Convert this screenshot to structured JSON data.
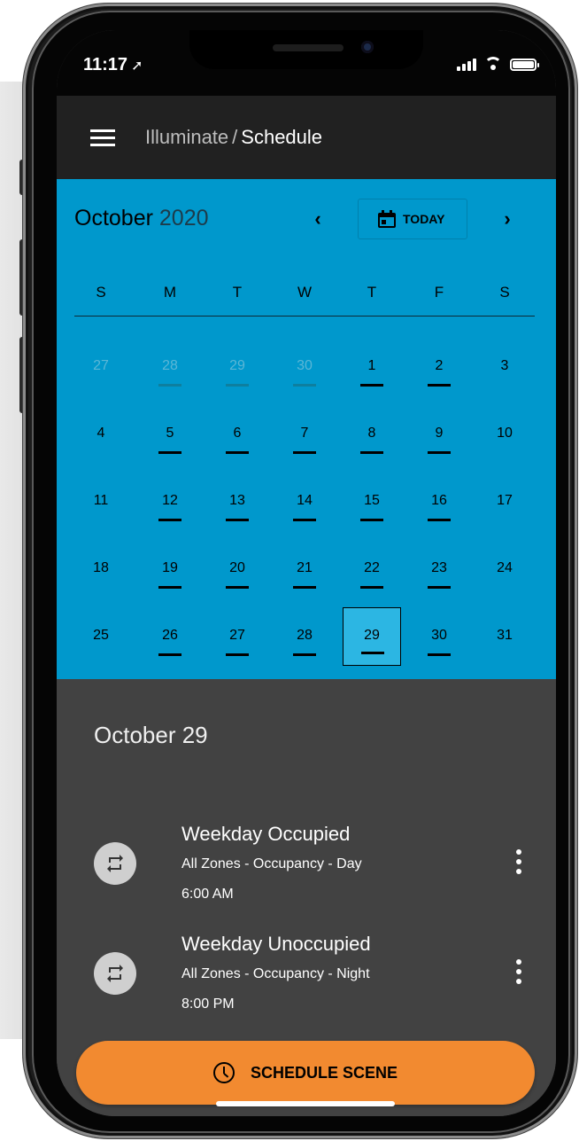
{
  "status_bar": {
    "time": "11:17",
    "location_glyph": "➚"
  },
  "app_bar": {
    "breadcrumb": "Illuminate",
    "separator": "/",
    "title": "Schedule"
  },
  "calendar": {
    "month": "October",
    "year": "2020",
    "today_label": "TODAY",
    "prev_glyph": "‹",
    "next_glyph": "›",
    "weekdays": [
      "S",
      "M",
      "T",
      "W",
      "T",
      "F",
      "S"
    ],
    "weeks": [
      [
        "27",
        "28",
        "29",
        "30",
        "1",
        "2",
        "3"
      ],
      [
        "4",
        "5",
        "6",
        "7",
        "8",
        "9",
        "10"
      ],
      [
        "11",
        "12",
        "13",
        "14",
        "15",
        "16",
        "17"
      ],
      [
        "18",
        "19",
        "20",
        "21",
        "22",
        "23",
        "24"
      ],
      [
        "25",
        "26",
        "27",
        "28",
        "29",
        "30",
        "31"
      ]
    ],
    "selected_date": "29"
  },
  "events_panel": {
    "date_heading": "October 29",
    "events": [
      {
        "title": "Weekday Occupied",
        "subtitle": "All Zones - Occupancy - Day",
        "time": "6:00 AM",
        "icon": "repeat-icon"
      },
      {
        "title": "Weekday Unoccupied",
        "subtitle": "All Zones - Occupancy - Night",
        "time": "8:00 PM",
        "icon": "repeat-icon"
      }
    ],
    "schedule_button": "SCHEDULE SCENE"
  },
  "colors": {
    "calendar_bg": "#0098cc",
    "app_bar_bg": "#212121",
    "panel_bg": "#424242",
    "accent_orange": "#f28a30",
    "selected_day_bg": "#2cb6e3"
  }
}
